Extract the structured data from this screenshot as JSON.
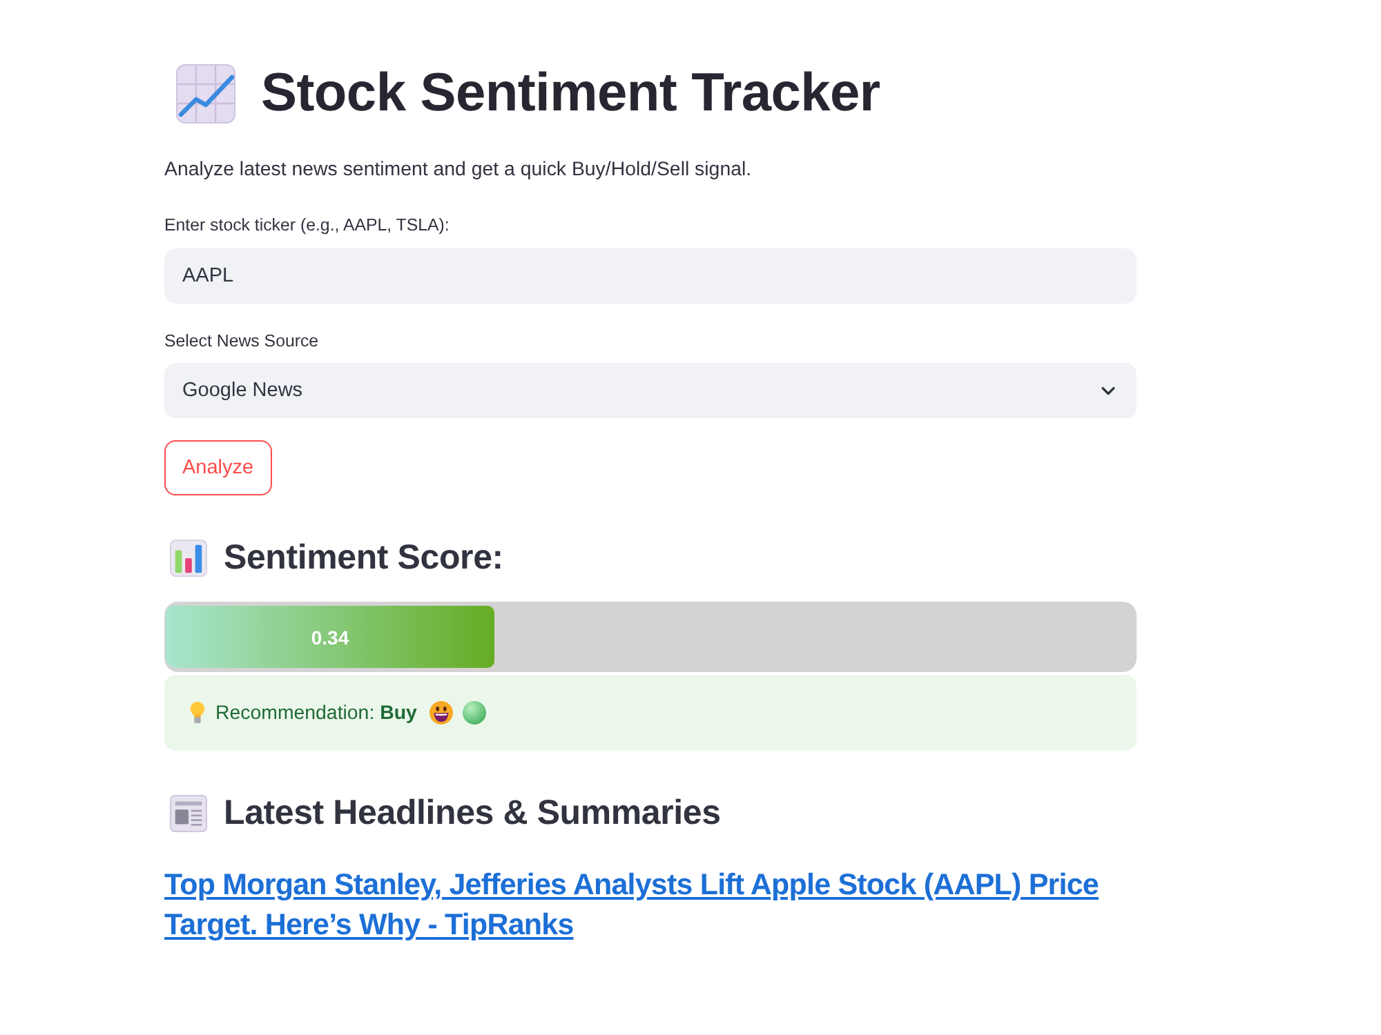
{
  "header": {
    "title": "Stock Sentiment Tracker",
    "subtitle": "Analyze latest news sentiment and get a quick Buy/Hold/Sell signal."
  },
  "ticker_field": {
    "label": "Enter stock ticker (e.g., AAPL, TSLA):",
    "value": "AAPL"
  },
  "source_select": {
    "label": "Select News Source",
    "value": "Google News"
  },
  "analyze_button": {
    "label": "Analyze"
  },
  "sentiment": {
    "heading": "Sentiment Score:",
    "level": 0.34,
    "reading": "0.34",
    "recommendation": "Recommendation: **Buy**"
  },
  "headlines": {
    "heading": "Latest Headlines & Summaries",
    "items": [
      {
        "title": "Top Morgan Stanley, Jefferies Analysts Lift Apple Stock (AAPL) Price Target. Here’s Why - TipRanks"
      }
    ]
  }
}
